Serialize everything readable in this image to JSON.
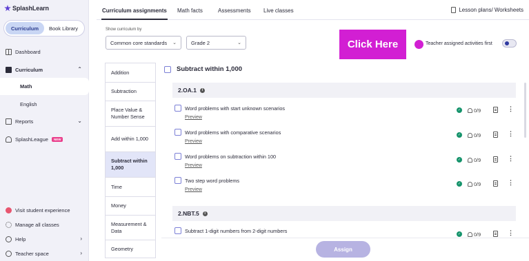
{
  "brand": {
    "name": "SplashLearn"
  },
  "sidebar": {
    "toggle": {
      "options": [
        "Curriculum",
        "Book Library"
      ],
      "active": "Curriculum"
    },
    "nav": {
      "dashboard": "Dashboard",
      "curriculum": "Curriculum",
      "curriculum_children": [
        "Math",
        "English"
      ],
      "reports": "Reports",
      "splashleague": "SplashLeague",
      "new_badge": "NEW"
    },
    "bottom": [
      "Visit student experience",
      "Manage all classes",
      "Help",
      "Teacher space"
    ]
  },
  "tabs": [
    "Curriculum assignments",
    "Math facts",
    "Assessments",
    "Live classes"
  ],
  "active_tab": "Curriculum assignments",
  "lesson_link": "Lesson plans/ Worksheets",
  "filters": {
    "label": "Show curriculum by",
    "curriculum_value": "Common core standards",
    "grade_value": "Grade 2",
    "teacher_assigned_label": "Teacher assigned activities first"
  },
  "callout": "Click Here",
  "topics": [
    "Addition",
    "Subtraction",
    "Place Value & Number Sense",
    "Add within 1,000",
    "Subtract within 1,000",
    "Time",
    "Money",
    "Measurement & Data",
    "Geometry"
  ],
  "active_topic": "Subtract within 1,000",
  "content": {
    "title": "Subtract within 1,000",
    "sections": [
      {
        "code": "2.OA.1",
        "activities": [
          {
            "title": "Word problems with start unknown scenarios",
            "link": "Preview",
            "count": "0/9"
          },
          {
            "title": "Word problems with comparative scenarios",
            "link": "Preview",
            "count": "0/9"
          },
          {
            "title": "Word problems on subtraction within 100",
            "link": "Preview",
            "count": "0/9"
          },
          {
            "title": "Two step word problems",
            "link": "Preview",
            "count": "0/9"
          }
        ]
      },
      {
        "code": "2.NBT.5",
        "activities": [
          {
            "title": "Subtract 1-digit numbers from 2-digit numbers",
            "count": "0/9"
          }
        ]
      }
    ]
  },
  "assign_button": "Assign",
  "colors": {
    "brand_purple": "#5d3fd3",
    "callout_magenta": "#d21fd3",
    "status_green": "#15936b",
    "assign_disabled": "#b7b3e2"
  }
}
